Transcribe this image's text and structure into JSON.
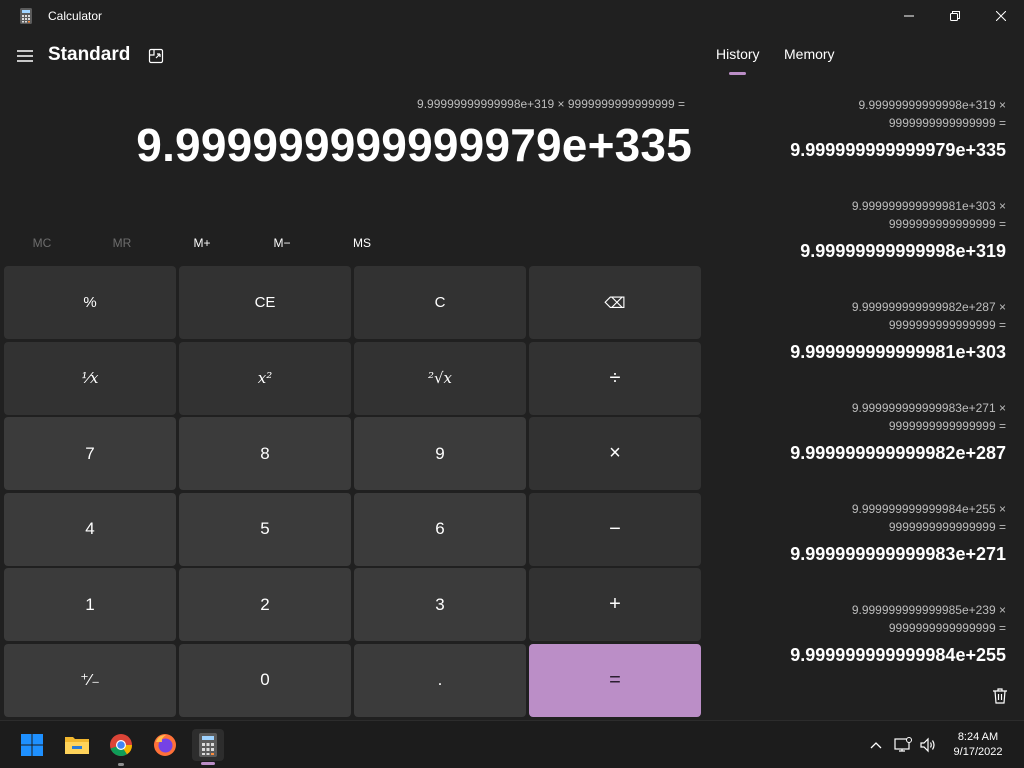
{
  "window": {
    "title": "Calculator"
  },
  "header": {
    "mode": "Standard"
  },
  "display": {
    "expression": "9.99999999999998e+319 × 9999999999999999 =",
    "result": "9.999999999999979e+335"
  },
  "memory_buttons": [
    {
      "label": "MC",
      "enabled": false
    },
    {
      "label": "MR",
      "enabled": false
    },
    {
      "label": "M+",
      "enabled": true
    },
    {
      "label": "M−",
      "enabled": true
    },
    {
      "label": "MS",
      "enabled": true
    }
  ],
  "keys": [
    [
      "%",
      "CE",
      "C",
      "⌫"
    ],
    [
      "⅟x",
      "x²",
      "²√x",
      "÷"
    ],
    [
      "7",
      "8",
      "9",
      "×"
    ],
    [
      "4",
      "5",
      "6",
      "−"
    ],
    [
      "1",
      "2",
      "3",
      "+"
    ],
    [
      "⁺∕₋",
      "0",
      ".",
      "="
    ]
  ],
  "panel": {
    "tabs": [
      "History",
      "Memory"
    ],
    "active_tab": "History",
    "history": [
      {
        "expr1": "9.99999999999998e+319  ×",
        "expr2": "9999999999999999  =",
        "result": "9.999999999999979e+335"
      },
      {
        "expr1": "9.999999999999981e+303  ×",
        "expr2": "9999999999999999  =",
        "result": "9.99999999999998e+319"
      },
      {
        "expr1": "9.999999999999982e+287  ×",
        "expr2": "9999999999999999  =",
        "result": "9.999999999999981e+303"
      },
      {
        "expr1": "9.999999999999983e+271  ×",
        "expr2": "9999999999999999  =",
        "result": "9.999999999999982e+287"
      },
      {
        "expr1": "9.999999999999984e+255  ×",
        "expr2": "9999999999999999  =",
        "result": "9.999999999999983e+271"
      },
      {
        "expr1": "9.999999999999985e+239  ×",
        "expr2": "9999999999999999  =",
        "result": "9.999999999999984e+255"
      }
    ]
  },
  "taskbar": {
    "time": "8:24 AM",
    "date": "9/17/2022"
  },
  "colors": {
    "accent": "#bb8ec7",
    "background": "#202020",
    "key_number": "#3b3b3b",
    "key_function": "#323232"
  }
}
